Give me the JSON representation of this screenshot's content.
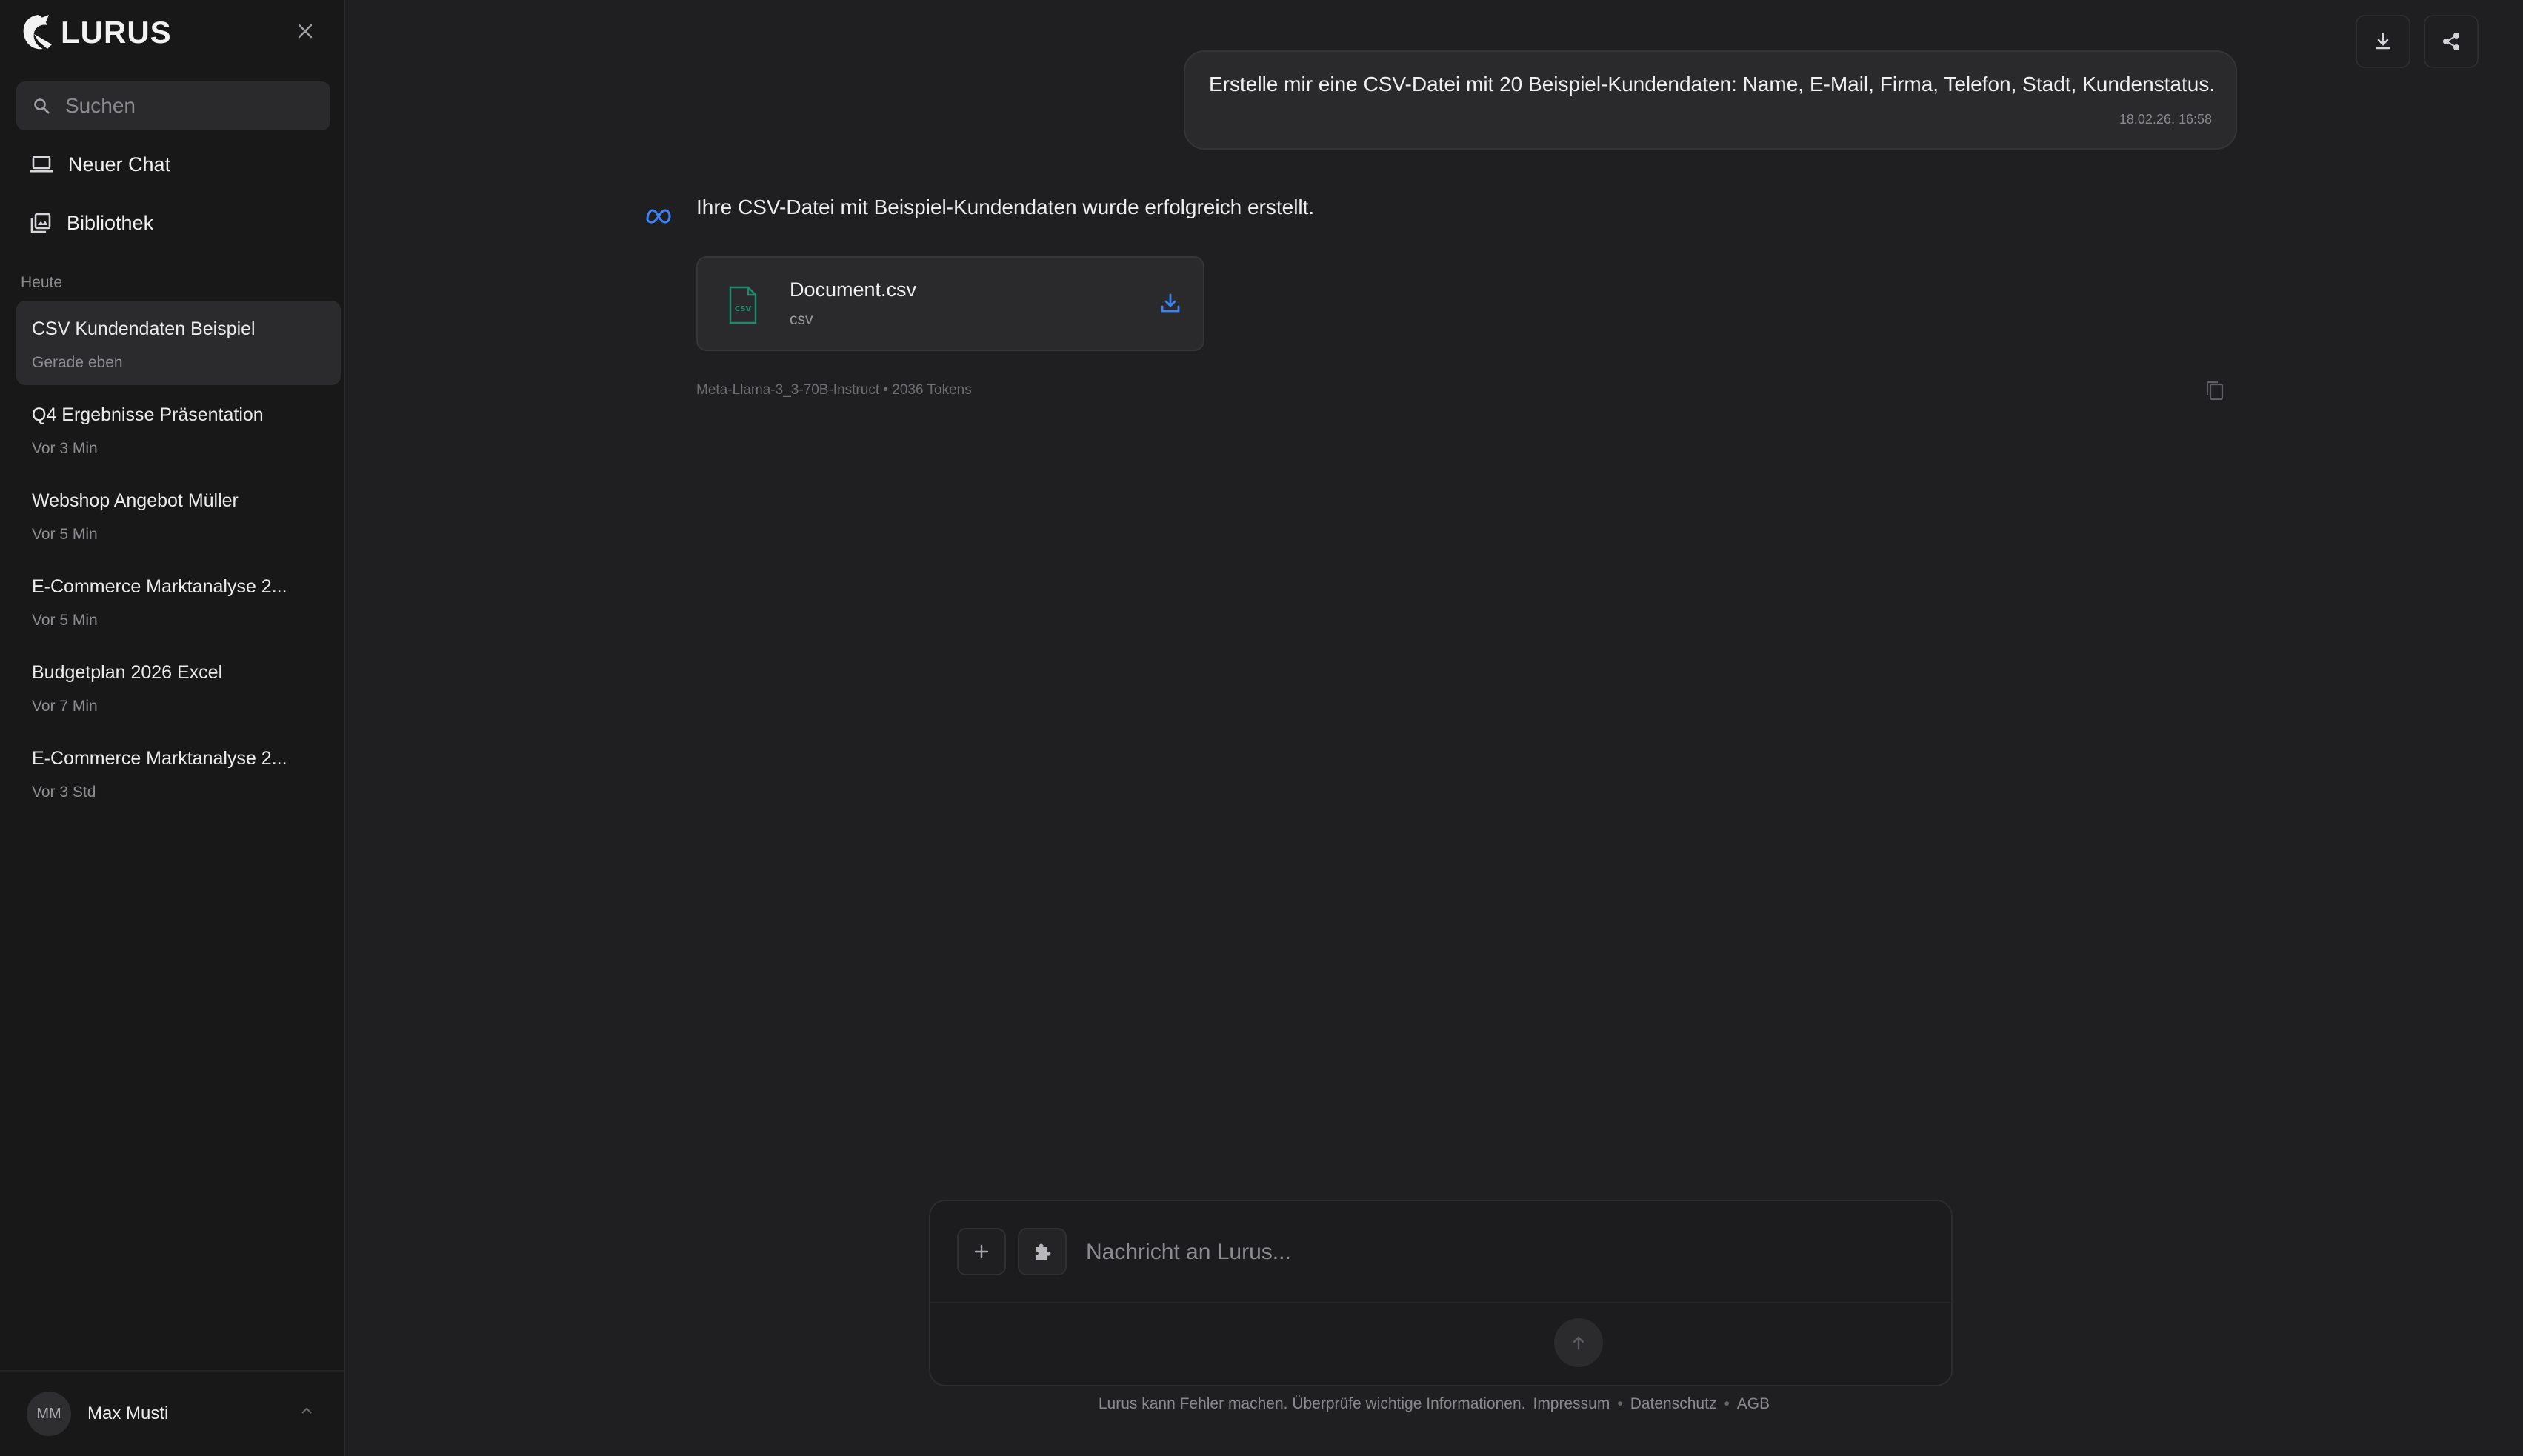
{
  "brand": {
    "name": "LURUS"
  },
  "sidebar": {
    "search_placeholder": "Suchen",
    "nav": [
      {
        "label": "Neuer Chat",
        "icon": "laptop-icon"
      },
      {
        "label": "Bibliothek",
        "icon": "library-icon"
      }
    ],
    "section_label": "Heute",
    "conversations": [
      {
        "title": "CSV Kundendaten Beispiel",
        "time": "Gerade eben",
        "active": true
      },
      {
        "title": "Q4 Ergebnisse Präsentation",
        "time": "Vor 3 Min"
      },
      {
        "title": "Webshop Angebot Müller",
        "time": "Vor 5 Min"
      },
      {
        "title": "E-Commerce Marktanalyse 2...",
        "time": "Vor 5 Min"
      },
      {
        "title": "Budgetplan 2026 Excel",
        "time": "Vor 7 Min"
      },
      {
        "title": "E-Commerce Marktanalyse 2...",
        "time": "Vor 3 Std"
      }
    ],
    "user": {
      "initials": "MM",
      "name": "Max Musti"
    }
  },
  "chat": {
    "user_message": {
      "text": "Erstelle mir eine CSV-Datei mit 20 Beispiel-Kundendaten: Name, E-Mail, Firma, Telefon, Stadt, Kundenstatus.",
      "timestamp": "18.02.26, 16:58"
    },
    "assistant_message": {
      "text": "Ihre CSV-Datei mit Beispiel-Kundendaten wurde erfolgreich erstellt.",
      "file": {
        "name": "Document.csv",
        "type": "csv",
        "icon_label": "CSV"
      },
      "meta": "Meta-Llama-3_3-70B-Instruct • 2036 Tokens"
    }
  },
  "composer": {
    "placeholder": "Nachricht an Lurus..."
  },
  "footer": {
    "disclaimer": "Lurus kann Fehler machen. Überprüfe wichtige Informationen.",
    "links": [
      "Impressum",
      "Datenschutz",
      "AGB"
    ],
    "separator": "•"
  },
  "colors": {
    "accent_blue": "#3b82f6",
    "file_green": "#1f8a6a",
    "background": "#1f1f21",
    "sidebar": "#181819"
  }
}
